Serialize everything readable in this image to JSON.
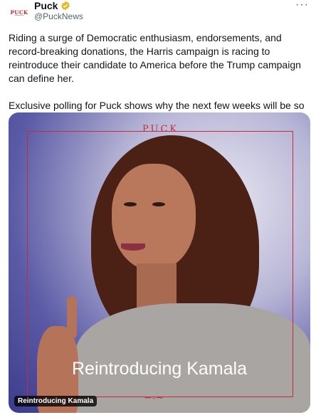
{
  "author": {
    "name": "Puck",
    "handle": "@PuckNews",
    "avatar_text": "PUCK",
    "verified_color": "#e8b923"
  },
  "tweet": {
    "paragraph1": "Riding a surge of Democratic enthusiasm, endorsements, and record-breaking donations, the Harris campaign is racing to reintroduce their candidate to America before the Trump campaign can define her.",
    "paragraph2": "Exclusive polling for Puck shows why the next few weeks will be so critical."
  },
  "media": {
    "brand_mark": "PUCK",
    "headline": "Reintroducing Kamala",
    "badge": "Reintroducing Kamala",
    "frame_color": "#c72a3a"
  },
  "more_label": "···"
}
